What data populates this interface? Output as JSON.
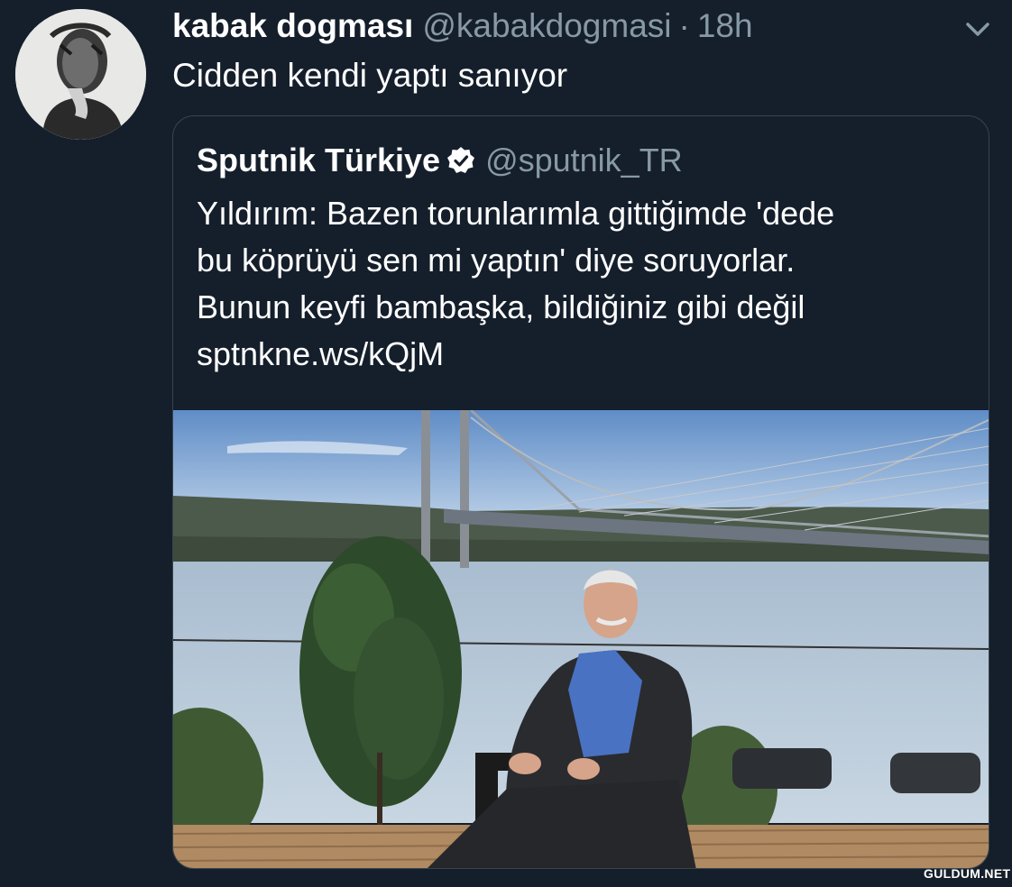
{
  "tweet": {
    "display_name": "kabak dogması",
    "handle": "@kabakdogmasi",
    "separator": "·",
    "time": "18h",
    "text": "Cidden kendi yaptı sanıyor",
    "menu_icon": "chevron-down-icon",
    "avatar_icon": "user-avatar"
  },
  "quoted": {
    "display_name": "Sputnik Türkiye",
    "verified_icon": "verified-badge-icon",
    "handle": "@sputnik_TR",
    "lines": [
      "Yıldırım: Bazen torunlarımla gittiğimde 'dede",
      "bu köprüyü sen mi yaptın' diye soruyorlar.",
      "Bunun keyfi bambaşka, bildiğiniz gibi değil",
      "sptnkne.ws/kQjM"
    ],
    "image_icon": "bridge-photo"
  },
  "watermark": "GULDUM.NET",
  "colors": {
    "background": "#151f2b",
    "text": "#ffffff",
    "muted": "#8899a6",
    "border": "#38444d"
  }
}
